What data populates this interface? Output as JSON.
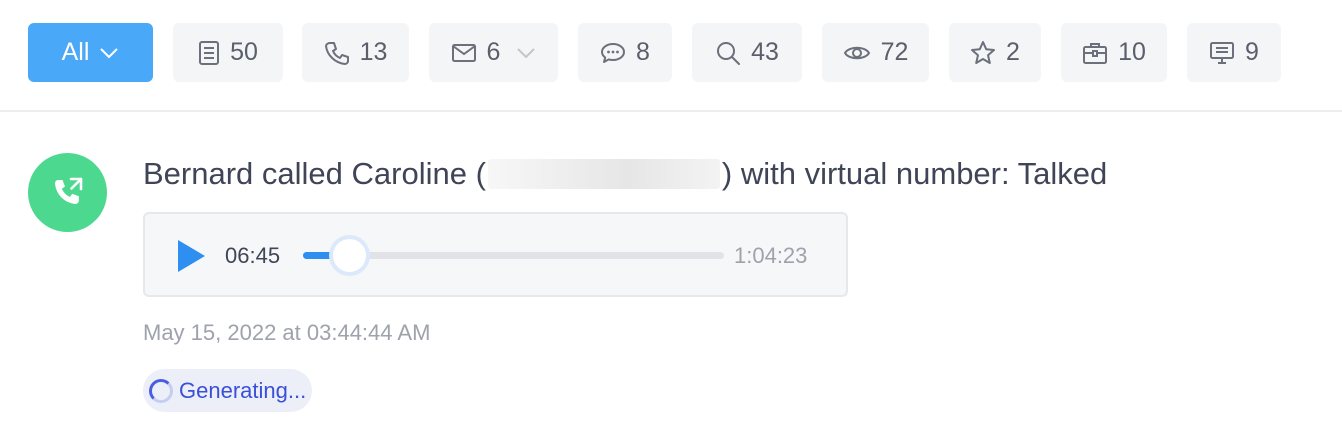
{
  "filters": {
    "all": {
      "label": "All",
      "icon": "chevron-down-icon"
    },
    "notes": {
      "count": "50",
      "icon": "document-icon"
    },
    "calls": {
      "count": "13",
      "icon": "phone-icon"
    },
    "emails": {
      "count": "6",
      "icon": "envelope-icon"
    },
    "messages": {
      "count": "8",
      "icon": "chat-bubble-icon"
    },
    "searches": {
      "count": "43",
      "icon": "search-icon"
    },
    "views": {
      "count": "72",
      "icon": "eye-icon"
    },
    "favorites": {
      "count": "2",
      "icon": "star-icon"
    },
    "jobs": {
      "count": "10",
      "icon": "briefcase-icon"
    },
    "screens": {
      "count": "9",
      "icon": "monitor-icon"
    }
  },
  "activity": {
    "icon": "outgoing-call-icon",
    "headline_before": "Bernard called Caroline (",
    "headline_after": ") with virtual number: Talked",
    "player": {
      "current_time": "06:45",
      "total_time": "1:04:23",
      "progress": 0.105
    },
    "timestamp": "May 15, 2022 at 03:44:44 AM",
    "status_label": "Generating..."
  },
  "colors": {
    "accent": "#4aa8f9",
    "call_green": "#4dd890",
    "progress_blue": "#2e8ff0",
    "status_blue": "#3b4fd8"
  }
}
